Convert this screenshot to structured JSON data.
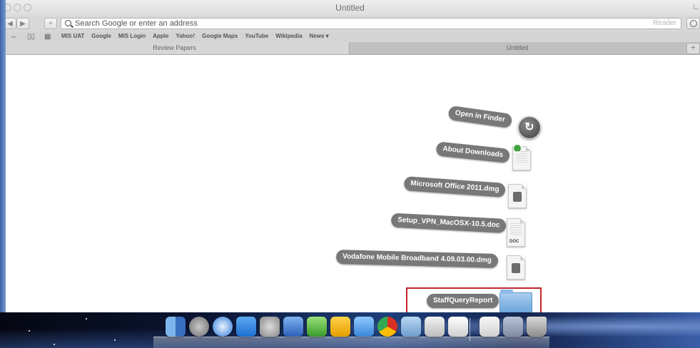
{
  "window": {
    "title": "Untitled"
  },
  "toolbar": {
    "back_icon": "back-arrow-icon",
    "forward_icon": "forward-arrow-icon",
    "add_icon": "plus-icon",
    "address_placeholder": "Search Google or enter an address",
    "reader_label": "Reader"
  },
  "bookmarks": {
    "items": [
      "MIS UAT",
      "Google",
      "MIS Login",
      "Apple",
      "Yahoo!",
      "Google Maps",
      "YouTube",
      "Wikipedia",
      "News ▾"
    ]
  },
  "tabs": [
    {
      "label": "Review Papers"
    },
    {
      "label": "Untitled"
    }
  ],
  "stack": {
    "items": [
      {
        "label": "Open in Finder",
        "icon": "open-in-finder-icon"
      },
      {
        "label": "About Downloads",
        "icon": "document-icon"
      },
      {
        "label": "Microsoft Office 2011.dmg",
        "icon": "disk-image-icon"
      },
      {
        "label": "Setup_VPN_MacOSX-10.5.doc",
        "icon": "doc-file-icon",
        "tag": "DOC"
      },
      {
        "label": "Vodafone Mobile Broadband 4.09.03.00.dmg",
        "icon": "disk-image-icon"
      },
      {
        "label": "StaffQueryReport",
        "icon": "folder-icon"
      }
    ],
    "highlight_color": "#c0262d"
  },
  "dock": {
    "apps": [
      "finder-icon",
      "launchpad-icon",
      "safari-icon",
      "dropbox-icon",
      "system-preferences-icon",
      "word-icon",
      "excel-icon",
      "outlook-icon",
      "app-store-icon",
      "chrome-icon",
      "preview-icon",
      "mail-icon",
      "downloads-stack-icon",
      "documents-stack-icon",
      "trash-icon"
    ]
  }
}
